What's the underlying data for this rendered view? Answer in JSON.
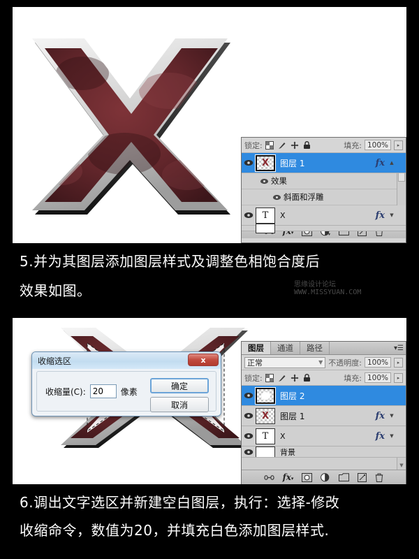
{
  "captions": {
    "step5_line1": "5.并为其图层添加图层样式及调整色相饱合度后",
    "step5_line2": "效果如图。",
    "watermark": "思缘设计论坛 WWW.MISSYUAN.COM",
    "step6_line1": "6.调出文字选区并新建空白图层，执行：选择-修改",
    "step6_line2": "收缩命令，数值为20，并填充白色添加图层样式."
  },
  "artwork": {
    "letter": "X",
    "fill_color": "#6b2a2e",
    "bevel_light": "#e8e8e8",
    "bevel_dark": "#2a2a2a"
  },
  "panel_top": {
    "lock_label": "锁定:",
    "fill_label": "填充:",
    "fill_value": "100%",
    "layers": [
      {
        "name": "图层 1",
        "selected": true,
        "has_fx": true,
        "thumb": "x-letter"
      },
      {
        "name": "效果",
        "type": "effects-group",
        "indent": 1
      },
      {
        "name": "斜面和浮雕",
        "type": "effect",
        "indent": 2
      },
      {
        "name": "X",
        "selected": false,
        "has_fx": true,
        "thumb": "type-T"
      }
    ]
  },
  "panel_bottom": {
    "tabs": [
      {
        "label": "图层",
        "active": true
      },
      {
        "label": "通道",
        "active": false
      },
      {
        "label": "路径",
        "active": false
      }
    ],
    "blend_mode": "正常",
    "opacity_label": "不透明度:",
    "opacity_value": "100%",
    "lock_label": "锁定:",
    "fill_label": "填充:",
    "fill_value": "100%",
    "layers": [
      {
        "name": "图层 2",
        "selected": true,
        "has_fx": false,
        "thumb": "white-blob"
      },
      {
        "name": "图层 1",
        "selected": false,
        "has_fx": true,
        "thumb": "x-letter"
      },
      {
        "name": "X",
        "selected": false,
        "has_fx": true,
        "thumb": "type-T"
      },
      {
        "name": "背景",
        "selected": false,
        "has_fx": false,
        "thumb": "white",
        "partial": true
      }
    ]
  },
  "dialog": {
    "title": "收缩选区",
    "close_label": "x",
    "field_label": "收缩量(C):",
    "field_value": "20",
    "unit_label": "像素",
    "ok_label": "确定",
    "cancel_label": "取消"
  },
  "footer_icons": [
    "link-icon",
    "fx-icon",
    "mask-icon",
    "adjustment-icon",
    "folder-icon",
    "new-layer-icon",
    "trash-icon"
  ]
}
